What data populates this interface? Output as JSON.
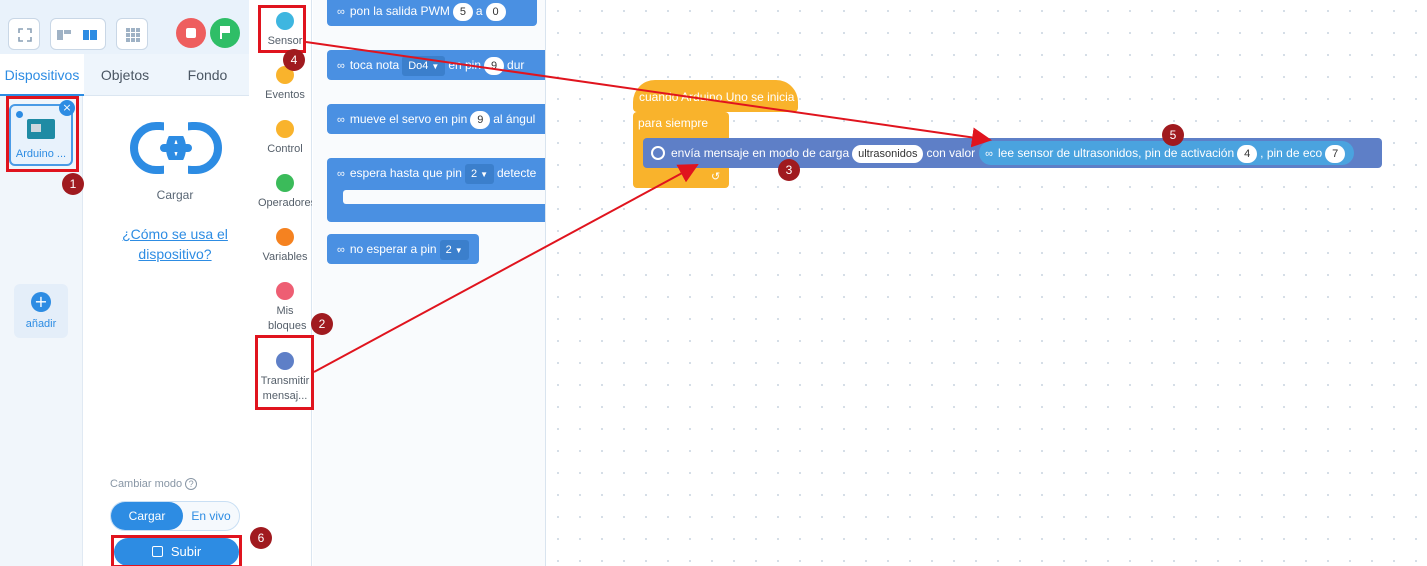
{
  "toolbar": {
    "icons": [
      "fullscreen-icon",
      "layout-icon",
      "layout-active-icon",
      "grid-icon",
      "stop-icon",
      "green-flag-icon"
    ],
    "colors": {
      "stop": "#ee5e5e",
      "go": "#2fbe67",
      "accent": "#2d8ce3"
    }
  },
  "tabs": [
    "Dispositivos",
    "Objetos",
    "Fondo"
  ],
  "devices": {
    "items": [
      {
        "label": "Arduino ..."
      }
    ],
    "add_label": "añadir"
  },
  "device_detail": {
    "mode_button": "Cargar",
    "howto_link": "¿Cómo se usa el dispositivo?",
    "change_mode": "Cambiar modo",
    "help_glyph": "?",
    "mode_options": [
      "Cargar",
      "En vivo"
    ],
    "upload_label": "Subir"
  },
  "categories": [
    {
      "label": "Sensor",
      "color": "#3eb6e0"
    },
    {
      "label": "Eventos",
      "color": "#f9b32c"
    },
    {
      "label": "Control",
      "color": "#f9b32c"
    },
    {
      "label": "Operadores",
      "color": "#3bbb5a"
    },
    {
      "label": "Variables",
      "color": "#f58220"
    },
    {
      "label": "Mis bloques",
      "color": "#ee5e73"
    },
    {
      "label": "Transmitir mensaj...",
      "color": "#5e7fc7"
    }
  ],
  "palette": {
    "pwm": {
      "text": "pon la salida PWM",
      "pin": "5",
      "a": "a",
      "val": "0"
    },
    "tone": {
      "text": "toca nota",
      "note": "Do4",
      "en_pin": "en pin",
      "pin": "9",
      "dur": "dur"
    },
    "servo": {
      "text": "mueve el servo en pin",
      "pin": "9",
      "rest": "al ángul"
    },
    "wait": {
      "text": "espera hasta que pin",
      "pin": "2",
      "rest": "detecte"
    },
    "nowait": {
      "text": "no esperar a pin",
      "pin": "2"
    }
  },
  "script": {
    "hat": "cuando Arduino Uno se inicia",
    "forever": "para siempre",
    "send": {
      "text": "envía mensaje en modo de carga",
      "message": "ultrasonidos",
      "con_valor": "con valor",
      "sensor_text": "lee sensor de ultrasonidos, pin de activación",
      "trig": "4",
      "echo_text": ", pin de eco",
      "echo": "7"
    }
  },
  "annotations": [
    "1",
    "2",
    "3",
    "4",
    "5",
    "6"
  ]
}
